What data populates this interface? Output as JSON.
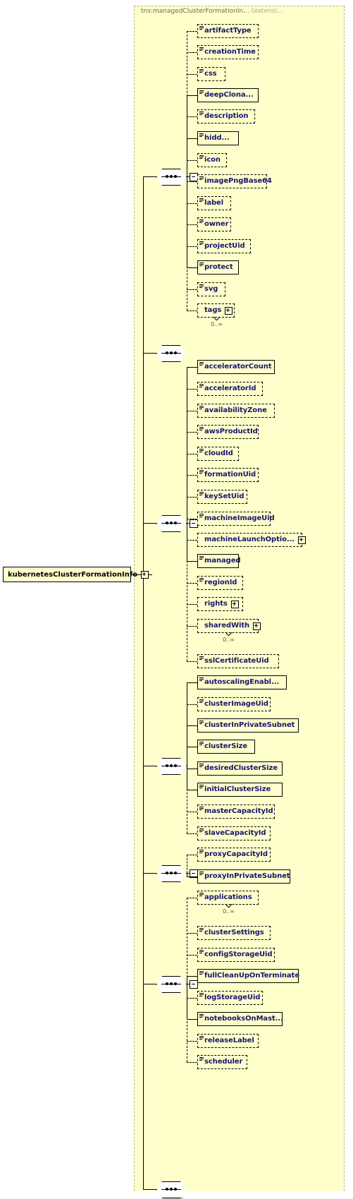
{
  "diagram": {
    "type": "xsd-schema-diagram",
    "root_element": "kubernetesClusterFormationInfo",
    "extension_title_tns": "tns:managedClusterFormationIn...",
    "extension_title_note": "(extensi...",
    "colors": {
      "panel_background": "#ffffcc",
      "node_background": "#ffffcc",
      "node_text": "#16166e",
      "shadow": "#c8c8c8",
      "line": "#000000",
      "cardinality_text": "#54542a",
      "title_text": "#7a7a52"
    },
    "cardinality_unbounded": "0..∞"
  },
  "groups": [
    {
      "name": "group-1-artifact-metadata",
      "compositor": "sequence",
      "collapsible": true,
      "elements": [
        {
          "label": "artifactType",
          "required": false,
          "attr_icon": true,
          "expandable": false,
          "cardinality": null
        },
        {
          "label": "creationTime",
          "required": false,
          "attr_icon": true,
          "expandable": false,
          "cardinality": null
        },
        {
          "label": "css",
          "required": false,
          "attr_icon": true,
          "expandable": false,
          "cardinality": null
        },
        {
          "label": "deepClona...",
          "required": true,
          "attr_icon": true,
          "expandable": false,
          "cardinality": null
        },
        {
          "label": "description",
          "required": false,
          "attr_icon": true,
          "expandable": false,
          "cardinality": null
        },
        {
          "label": "hidd...",
          "required": true,
          "attr_icon": true,
          "expandable": false,
          "cardinality": null
        },
        {
          "label": "icon",
          "required": false,
          "attr_icon": true,
          "expandable": false,
          "cardinality": null
        },
        {
          "label": "imagePngBase64",
          "required": false,
          "attr_icon": true,
          "expandable": false,
          "cardinality": null
        },
        {
          "label": "label",
          "required": false,
          "attr_icon": true,
          "expandable": false,
          "cardinality": null
        },
        {
          "label": "owner",
          "required": false,
          "attr_icon": true,
          "expandable": false,
          "cardinality": null
        },
        {
          "label": "projectUid",
          "required": false,
          "attr_icon": true,
          "expandable": false,
          "cardinality": null
        },
        {
          "label": "protect",
          "required": true,
          "attr_icon": true,
          "expandable": false,
          "cardinality": null
        },
        {
          "label": "svg",
          "required": false,
          "attr_icon": true,
          "expandable": false,
          "cardinality": null
        },
        {
          "label": "tags",
          "required": false,
          "attr_icon": false,
          "expandable": true,
          "cardinality": "0..∞"
        }
      ]
    },
    {
      "name": "group-2-empty-sequence",
      "compositor": "sequence",
      "collapsible": false,
      "elements": []
    },
    {
      "name": "group-3-cluster-formation",
      "compositor": "sequence",
      "collapsible": true,
      "elements": [
        {
          "label": "acceleratorCount",
          "required": true,
          "attr_icon": true,
          "expandable": false,
          "cardinality": null
        },
        {
          "label": "acceleratorId",
          "required": false,
          "attr_icon": true,
          "expandable": false,
          "cardinality": null
        },
        {
          "label": "availabilityZone",
          "required": false,
          "attr_icon": true,
          "expandable": false,
          "cardinality": null
        },
        {
          "label": "awsProductId",
          "required": false,
          "attr_icon": true,
          "expandable": false,
          "cardinality": null
        },
        {
          "label": "cloudId",
          "required": false,
          "attr_icon": true,
          "expandable": false,
          "cardinality": null
        },
        {
          "label": "formationUid",
          "required": false,
          "attr_icon": true,
          "expandable": false,
          "cardinality": null
        },
        {
          "label": "keySetUid",
          "required": false,
          "attr_icon": true,
          "expandable": false,
          "cardinality": null
        },
        {
          "label": "machineImageUid",
          "required": false,
          "attr_icon": true,
          "expandable": false,
          "cardinality": null
        },
        {
          "label": "machineLaunchOptio...",
          "required": false,
          "attr_icon": false,
          "expandable": true,
          "cardinality": null
        },
        {
          "label": "managed",
          "required": true,
          "attr_icon": true,
          "expandable": false,
          "cardinality": null
        },
        {
          "label": "regionId",
          "required": false,
          "attr_icon": true,
          "expandable": false,
          "cardinality": null
        },
        {
          "label": "rights",
          "required": false,
          "attr_icon": false,
          "expandable": true,
          "cardinality": null
        },
        {
          "label": "sharedWith",
          "required": false,
          "attr_icon": false,
          "expandable": true,
          "cardinality": "0..∞"
        },
        {
          "label": "sslCertificateUid",
          "required": false,
          "attr_icon": true,
          "expandable": false,
          "cardinality": null
        }
      ]
    },
    {
      "name": "group-4-cluster-sizing",
      "compositor": "sequence",
      "collapsible": false,
      "elements": [
        {
          "label": "autoscalingEnabl...",
          "required": true,
          "attr_icon": true,
          "expandable": false,
          "cardinality": null
        },
        {
          "label": "clusterImageUid",
          "required": false,
          "attr_icon": true,
          "expandable": false,
          "cardinality": null
        },
        {
          "label": "clusterInPrivateSubnet",
          "required": true,
          "attr_icon": true,
          "expandable": false,
          "cardinality": null
        },
        {
          "label": "clusterSize",
          "required": true,
          "attr_icon": true,
          "expandable": false,
          "cardinality": null
        },
        {
          "label": "desiredClusterSize",
          "required": true,
          "attr_icon": true,
          "expandable": false,
          "cardinality": null
        },
        {
          "label": "initialClusterSize",
          "required": true,
          "attr_icon": true,
          "expandable": false,
          "cardinality": null
        },
        {
          "label": "masterCapacityId",
          "required": false,
          "attr_icon": true,
          "expandable": false,
          "cardinality": null
        },
        {
          "label": "slaveCapacityId",
          "required": false,
          "attr_icon": true,
          "expandable": false,
          "cardinality": null
        }
      ]
    },
    {
      "name": "group-5-proxy",
      "compositor": "sequence",
      "collapsible": true,
      "elements": [
        {
          "label": "proxyCapacityId",
          "required": false,
          "attr_icon": true,
          "expandable": false,
          "cardinality": null
        },
        {
          "label": "proxyInPrivateSubnet",
          "required": true,
          "attr_icon": true,
          "expandable": false,
          "cardinality": null
        }
      ]
    },
    {
      "name": "group-6-applications-settings",
      "compositor": "sequence",
      "collapsible": true,
      "elements": [
        {
          "label": "applications",
          "required": false,
          "attr_icon": true,
          "expandable": false,
          "cardinality": "0..∞"
        },
        {
          "label": "clusterSettings",
          "required": false,
          "attr_icon": true,
          "expandable": false,
          "cardinality": null
        },
        {
          "label": "configStorageUid",
          "required": false,
          "attr_icon": true,
          "expandable": false,
          "cardinality": null
        },
        {
          "label": "fullCleanUpOnTerminate",
          "required": true,
          "attr_icon": true,
          "expandable": false,
          "cardinality": null
        },
        {
          "label": "logStorageUid",
          "required": false,
          "attr_icon": true,
          "expandable": false,
          "cardinality": null
        },
        {
          "label": "notebooksOnMast...",
          "required": true,
          "attr_icon": true,
          "expandable": false,
          "cardinality": null
        },
        {
          "label": "releaseLabel",
          "required": false,
          "attr_icon": true,
          "expandable": false,
          "cardinality": null
        },
        {
          "label": "scheduler",
          "required": false,
          "attr_icon": true,
          "expandable": false,
          "cardinality": null
        }
      ]
    },
    {
      "name": "group-7-trailing-sequence",
      "compositor": "sequence",
      "collapsible": false,
      "elements": []
    }
  ]
}
